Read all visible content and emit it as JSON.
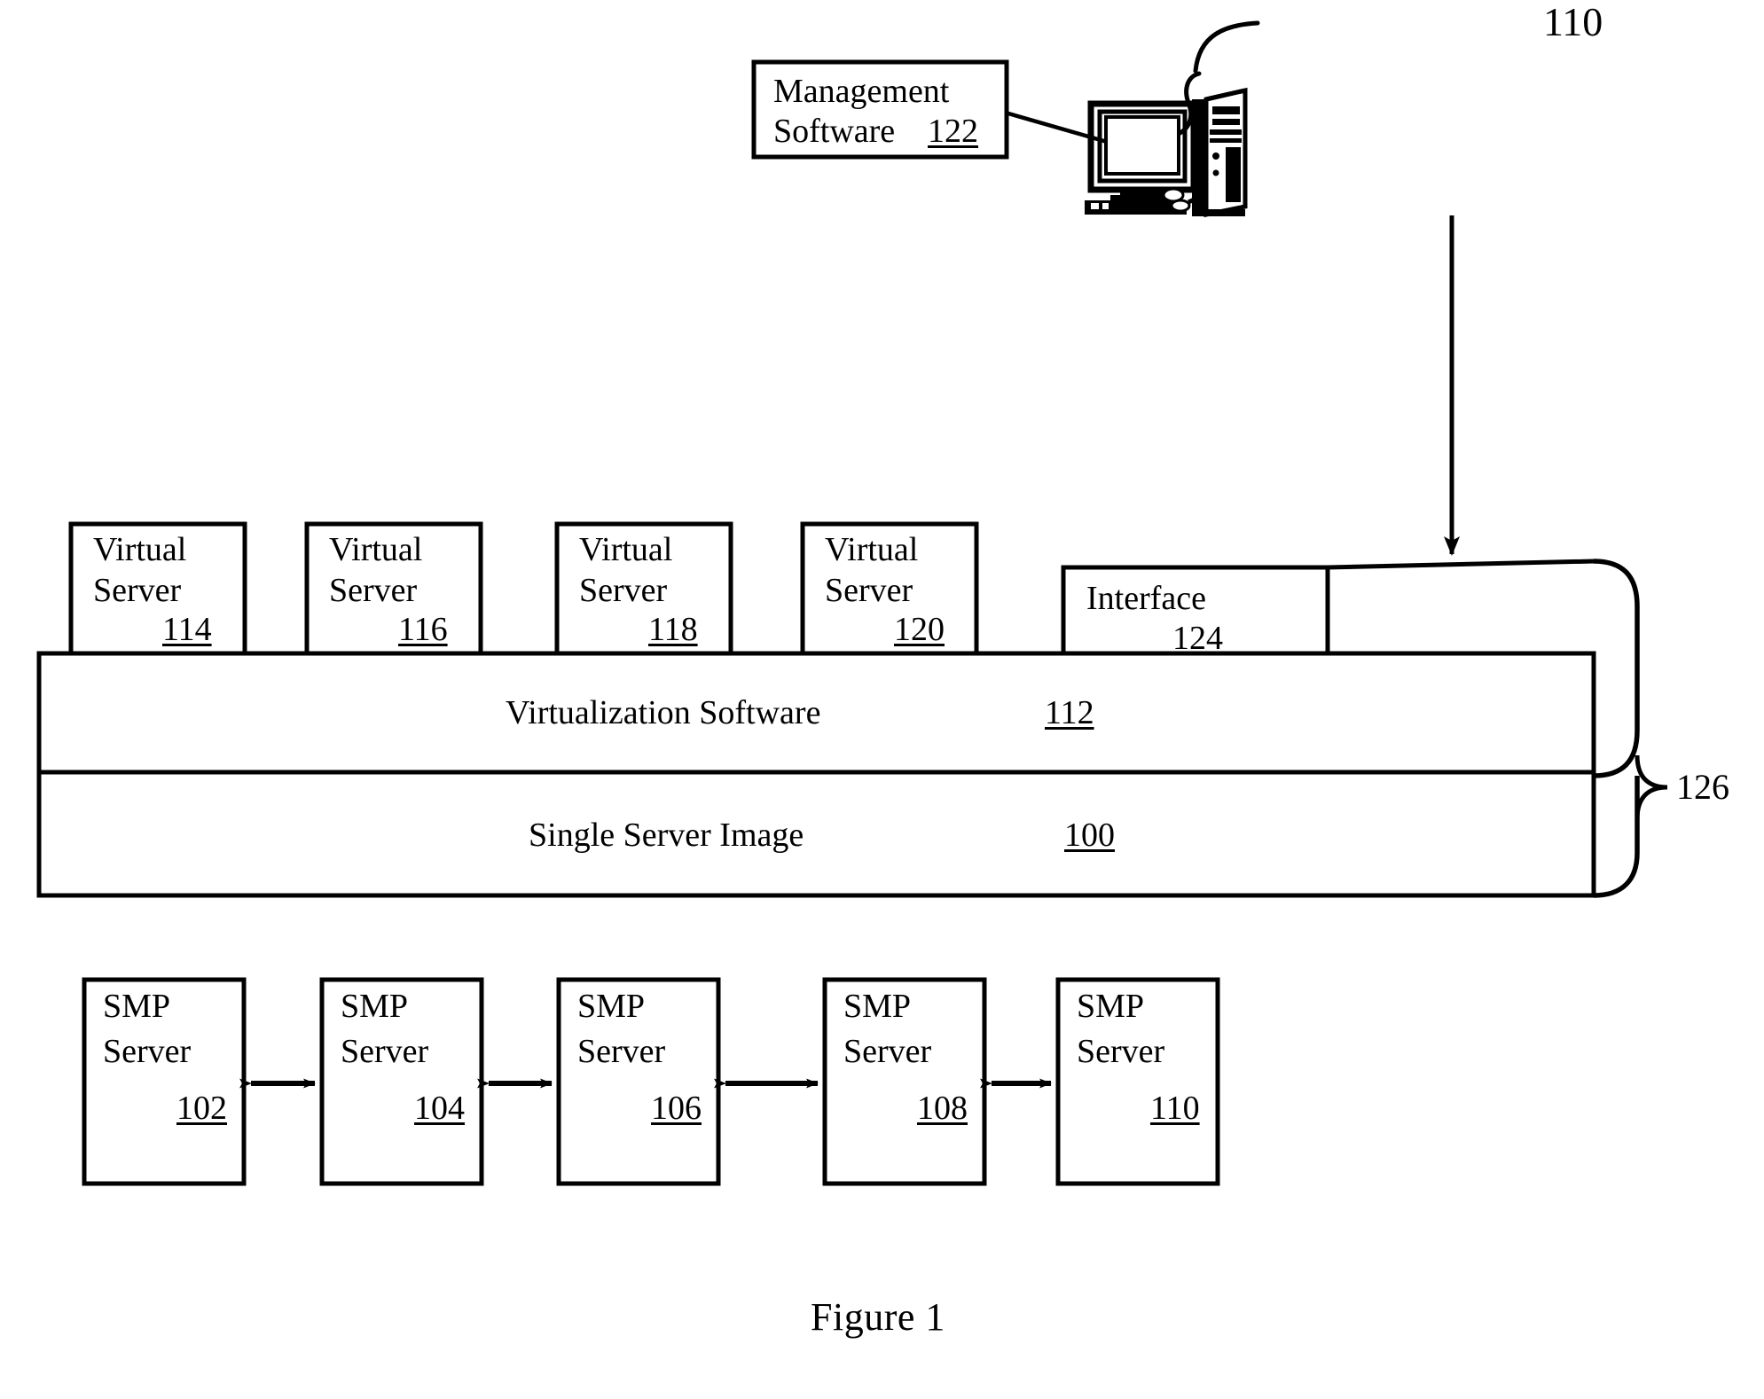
{
  "figure": {
    "caption": "Figure 1",
    "top_right_ref": "110"
  },
  "management": {
    "line1": "Management",
    "line2": "Software",
    "ref": "122"
  },
  "workstation": {
    "icon": "desktop-computer-icon"
  },
  "virtual_servers": [
    {
      "line1": "Virtual",
      "line2": "Server",
      "ref": "114"
    },
    {
      "line1": "Virtual",
      "line2": "Server",
      "ref": "116"
    },
    {
      "line1": "Virtual",
      "line2": "Server",
      "ref": "118"
    },
    {
      "line1": "Virtual",
      "line2": "Server",
      "ref": "120"
    }
  ],
  "interface_box": {
    "label": "Interface",
    "ref": "124"
  },
  "bands": [
    {
      "label": "Virtualization Software",
      "ref": "112"
    },
    {
      "label": "Single Server Image",
      "ref": "100"
    }
  ],
  "outer_bracket": {
    "ref": "126"
  },
  "smp_servers": [
    {
      "line1": "SMP",
      "line2": "Server",
      "ref": "102"
    },
    {
      "line1": "SMP",
      "line2": "Server",
      "ref": "104"
    },
    {
      "line1": "SMP",
      "line2": "Server",
      "ref": "106"
    },
    {
      "line1": "SMP",
      "line2": "Server",
      "ref": "108"
    },
    {
      "line1": "SMP",
      "line2": "Server",
      "ref": "110"
    }
  ],
  "colors": {
    "ink": "#000000",
    "paper": "#ffffff"
  }
}
